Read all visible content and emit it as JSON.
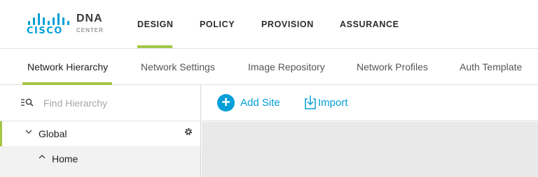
{
  "brand": {
    "logo_text": "CISCO",
    "product": "DNA",
    "product_sub": "CENTER",
    "accent_color": "#a3c644",
    "link_color": "#049fd9"
  },
  "topnav": {
    "items": [
      {
        "label": "DESIGN",
        "active": true
      },
      {
        "label": "POLICY",
        "active": false
      },
      {
        "label": "PROVISION",
        "active": false
      },
      {
        "label": "ASSURANCE",
        "active": false
      }
    ]
  },
  "subtabs": {
    "items": [
      {
        "label": "Network Hierarchy",
        "active": true
      },
      {
        "label": "Network Settings",
        "active": false
      },
      {
        "label": "Image Repository",
        "active": false
      },
      {
        "label": "Network Profiles",
        "active": false
      },
      {
        "label": "Auth Template",
        "active": false
      }
    ]
  },
  "sidebar": {
    "search_placeholder": "Find Hierarchy",
    "search_icon": "filter-search-icon",
    "tree": [
      {
        "label": "Global",
        "expand_icon": "chevron-down-icon",
        "settings_icon": "gear-icon"
      },
      {
        "label": "Home",
        "expand_icon": "chevron-up-icon"
      }
    ]
  },
  "toolbar": {
    "add_site_label": "Add Site",
    "add_icon": "plus-circle-icon",
    "import_label": "Import",
    "import_icon": "import-icon"
  }
}
